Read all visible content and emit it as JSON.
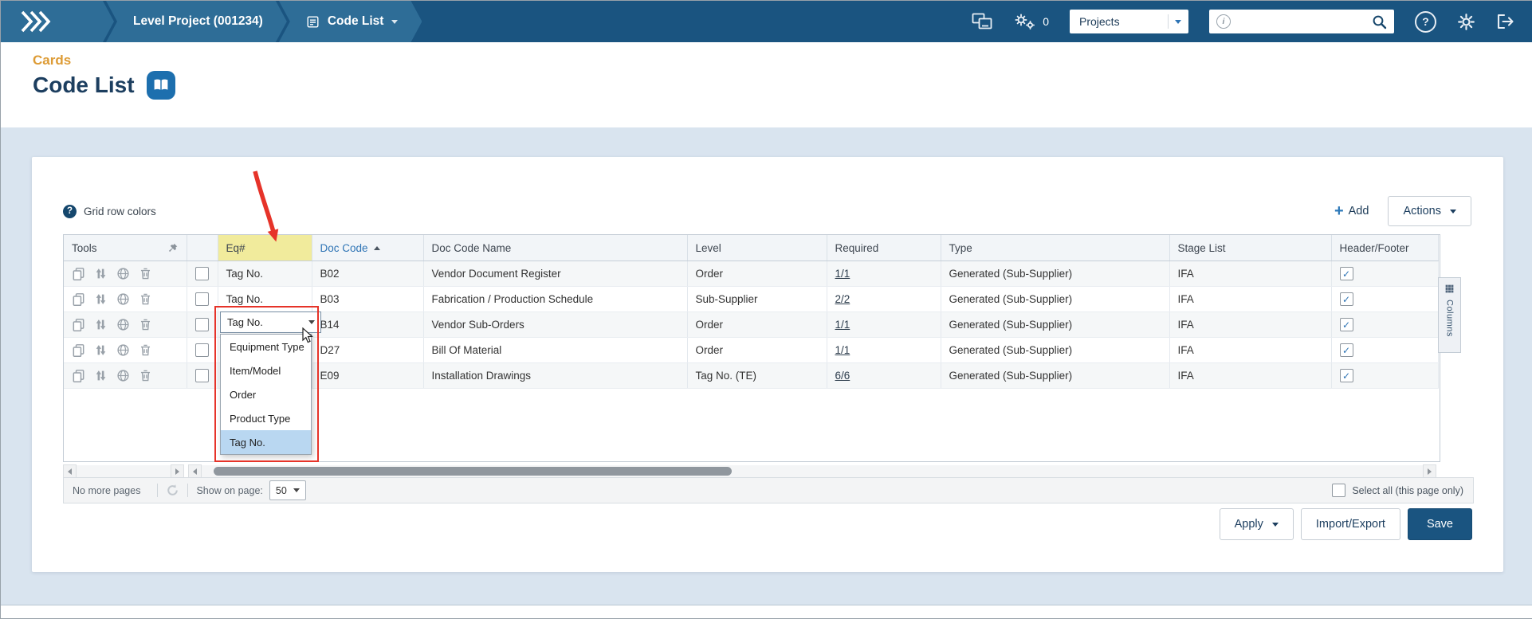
{
  "topbar": {
    "breadcrumb_project": "Level Project (001234)",
    "breadcrumb_page": "Code List",
    "gear_count": "0",
    "scope_selector": "Projects",
    "search_value": ""
  },
  "page_header": {
    "eyebrow": "Cards",
    "title": "Code List"
  },
  "toolbar": {
    "grid_row_colors": "Grid row colors",
    "add": "Add",
    "actions": "Actions"
  },
  "grid": {
    "columns": {
      "tools": "Tools",
      "eq": "Eq#",
      "doc_code": "Doc Code",
      "doc_code_name": "Doc Code Name",
      "level": "Level",
      "required": "Required",
      "type": "Type",
      "stage_list": "Stage List",
      "header_footer": "Header/Footer"
    },
    "rows": [
      {
        "eq": "Tag No.",
        "doc_code": "B02",
        "doc_code_name": "Vendor Document Register",
        "level": "Order",
        "required": "1/1",
        "type": "Generated (Sub-Supplier)",
        "stage_list": "IFA",
        "header_footer": true
      },
      {
        "eq": "Tag No.",
        "doc_code": "B03",
        "doc_code_name": "Fabrication / Production Schedule",
        "level": "Sub-Supplier",
        "required": "2/2",
        "type": "Generated (Sub-Supplier)",
        "stage_list": "IFA",
        "header_footer": true
      },
      {
        "eq": "",
        "doc_code": "B14",
        "doc_code_name": "Vendor Sub-Orders",
        "level": "Order",
        "required": "1/1",
        "type": "Generated (Sub-Supplier)",
        "stage_list": "IFA",
        "header_footer": true
      },
      {
        "eq": "",
        "doc_code": "D27",
        "doc_code_name": "Bill Of Material",
        "level": "Order",
        "required": "1/1",
        "type": "Generated (Sub-Supplier)",
        "stage_list": "IFA",
        "header_footer": true
      },
      {
        "eq": "",
        "doc_code": "E09",
        "doc_code_name": "Installation Drawings",
        "level": "Tag No. (TE)",
        "required": "6/6",
        "type": "Generated (Sub-Supplier)",
        "stage_list": "IFA",
        "header_footer": true
      }
    ],
    "columns_tab": "Columns"
  },
  "eq_dropdown": {
    "value": "Tag No.",
    "options": [
      "Equipment Type",
      "Item/Model",
      "Order",
      "Product Type",
      "Tag No."
    ],
    "selected_option": "Tag No."
  },
  "pager": {
    "status": "No more pages",
    "show_on_page_label": "Show on page:",
    "page_size": "50",
    "select_all_label": "Select all (this page only)"
  },
  "footer_buttons": {
    "apply": "Apply",
    "import_export": "Import/Export",
    "save": "Save"
  },
  "colors": {
    "topbar_navy": "#1a5480",
    "tab_blue": "#2e6d97",
    "accent_blue": "#2e74b5",
    "title_navy": "#1c3e5f",
    "eyebrow_orange": "#dd9b35",
    "highlight_yellow": "#f1eb9c",
    "selected_option_blue": "#b9d7f1",
    "annotation_red": "#e63329"
  }
}
